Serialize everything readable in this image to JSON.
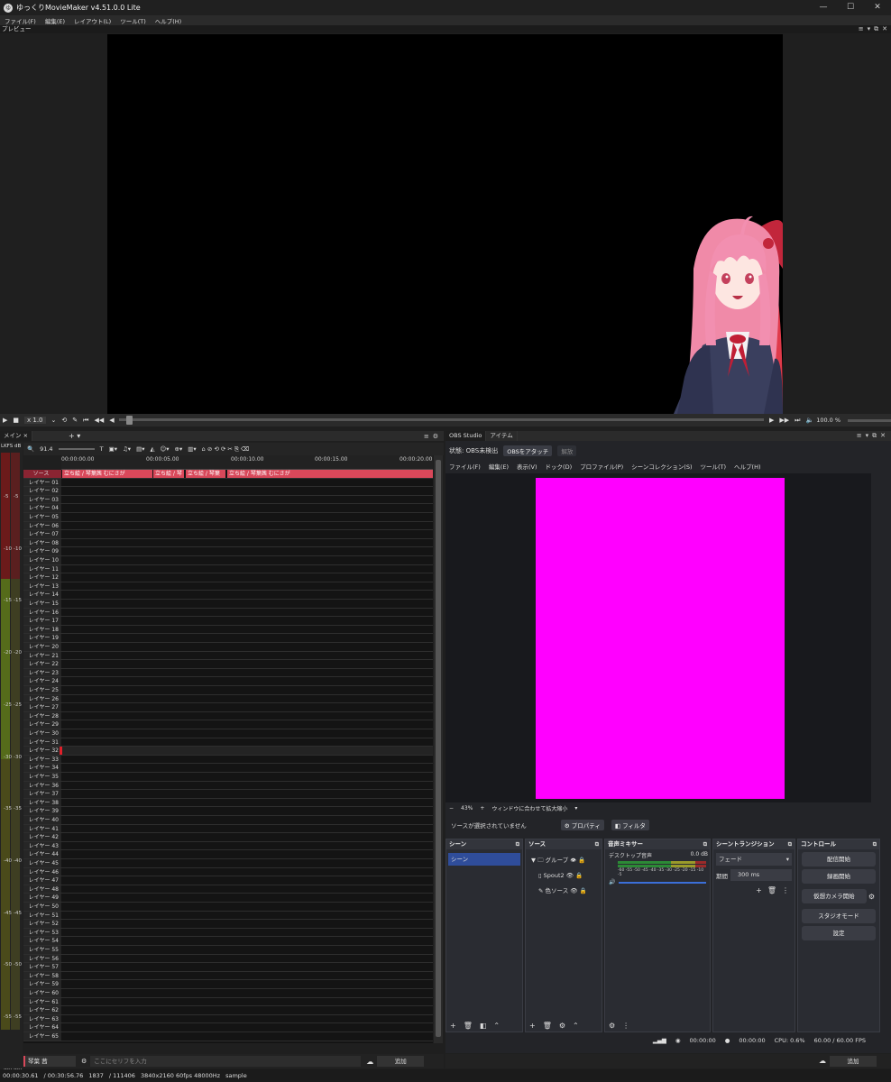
{
  "app": {
    "title": "ゆっくりMovieMaker v4.51.0.0 Lite"
  },
  "window_buttons": [
    "—",
    "☐",
    "✕"
  ],
  "menu": [
    "ファイル(F)",
    "編集(E)",
    "レイアウト(L)",
    "ツール(T)",
    "ヘルプ(H)"
  ],
  "preview": {
    "label": "プレビュー"
  },
  "playback": {
    "speed": "x 1.0",
    "volume": "100.0 %"
  },
  "timeline": {
    "tab": "メイン",
    "zoom": "91.4",
    "meter_label": "LKFS",
    "meter_unit": "dB",
    "meter_ticks": [
      "-5",
      "-10",
      "-15",
      "-20",
      "-25",
      "-30",
      "-35",
      "-40",
      "-45",
      "-50",
      "-55",
      "-60"
    ],
    "meter_ticks_right": [
      "-5",
      "-10",
      "-15",
      "-20",
      "-25",
      "-30",
      "-35",
      "-40",
      "-45",
      "-50",
      "-55",
      "-60"
    ],
    "time_ticks": [
      "00:00:00.00",
      "00:00:05.00",
      "00:00:10.00",
      "00:00:15.00",
      "00:00:20.00"
    ],
    "source_label": "ソース",
    "clips": [
      "立ち絵 / 琴葉茜 むにさが",
      "立ち絵 / 琴",
      "立ち絵 / 琴葉",
      "立ち絵 / 琴葉茜 むにさが"
    ],
    "layers": [
      "レイヤー 01",
      "レイヤー 02",
      "レイヤー 03",
      "レイヤー 04",
      "レイヤー 05",
      "レイヤー 06",
      "レイヤー 07",
      "レイヤー 08",
      "レイヤー 09",
      "レイヤー 10",
      "レイヤー 11",
      "レイヤー 12",
      "レイヤー 13",
      "レイヤー 14",
      "レイヤー 15",
      "レイヤー 16",
      "レイヤー 17",
      "レイヤー 18",
      "レイヤー 19",
      "レイヤー 20",
      "レイヤー 21",
      "レイヤー 22",
      "レイヤー 23",
      "レイヤー 24",
      "レイヤー 25",
      "レイヤー 26",
      "レイヤー 27",
      "レイヤー 28",
      "レイヤー 29",
      "レイヤー 30",
      "レイヤー 31",
      "レイヤー 32",
      "レイヤー 33",
      "レイヤー 34",
      "レイヤー 35",
      "レイヤー 36",
      "レイヤー 37",
      "レイヤー 38",
      "レイヤー 39",
      "レイヤー 40",
      "レイヤー 41",
      "レイヤー 42",
      "レイヤー 43",
      "レイヤー 44",
      "レイヤー 45",
      "レイヤー 46",
      "レイヤー 47",
      "レイヤー 48",
      "レイヤー 49",
      "レイヤー 50",
      "レイヤー 51",
      "レイヤー 52",
      "レイヤー 53",
      "レイヤー 54",
      "レイヤー 55",
      "レイヤー 56",
      "レイヤー 57",
      "レイヤー 58",
      "レイヤー 59",
      "レイヤー 60",
      "レイヤー 61",
      "レイヤー 62",
      "レイヤー 63",
      "レイヤー 64",
      "レイヤー 65"
    ]
  },
  "serif": {
    "speaker": "琴葉 茜",
    "placeholder": "ここにセリフを入力",
    "add": "追加"
  },
  "status": {
    "time": "00:00:30.61",
    "total": "/ 00:30:56.76",
    "frame": "1837",
    "frames": "/ 111406",
    "format": "3840x2160 60fps 48000Hz",
    "project": "sample"
  },
  "obs": {
    "tabs": [
      "OBS Studio",
      "アイテム"
    ],
    "state": "状態: OBS未検出",
    "attach": "OBSをアタッチ",
    "release": "解放",
    "menu": [
      "ファイル(F)",
      "編集(E)",
      "表示(V)",
      "ドック(D)",
      "プロファイル(P)",
      "シーンコレクション(S)",
      "ツール(T)",
      "ヘルプ(H)"
    ],
    "zoom": "43%",
    "fit": "ウィンドウに合わせて拡大縮小",
    "no_source": "ソースが選択されていません",
    "properties": "プロパティ",
    "filter": "フィルタ",
    "scenes_title": "シーン",
    "scene_item": "シーン",
    "sources_title": "ソース",
    "sources": [
      "グループ",
      "Spout2",
      "色ソース"
    ],
    "mixer_title": "音声ミキサー",
    "mixer_track": "デスクトップ音声",
    "mixer_db": "0.0 dB",
    "mixer_scale": "-60 -55 -50 -45 -40 -35 -30 -25 -20 -15 -10 -5",
    "transition_title": "シーントランジション",
    "transition": "フェード",
    "duration_label": "期間",
    "duration": "300 ms",
    "controls_title": "コントロール",
    "controls": [
      "配信開始",
      "録画開始",
      "仮想カメラ開始",
      "スタジオモード",
      "設定"
    ],
    "status_rec": "00:00:00",
    "status_stream": "00:00:00",
    "cpu": "CPU: 0.6%",
    "fps": "60.00 / 60.00 FPS",
    "add": "追加"
  },
  "colors": {
    "accent_clip": "#d9485a",
    "obs_magenta": "#ff00ff",
    "scene_selected": "#2f4d9a"
  }
}
